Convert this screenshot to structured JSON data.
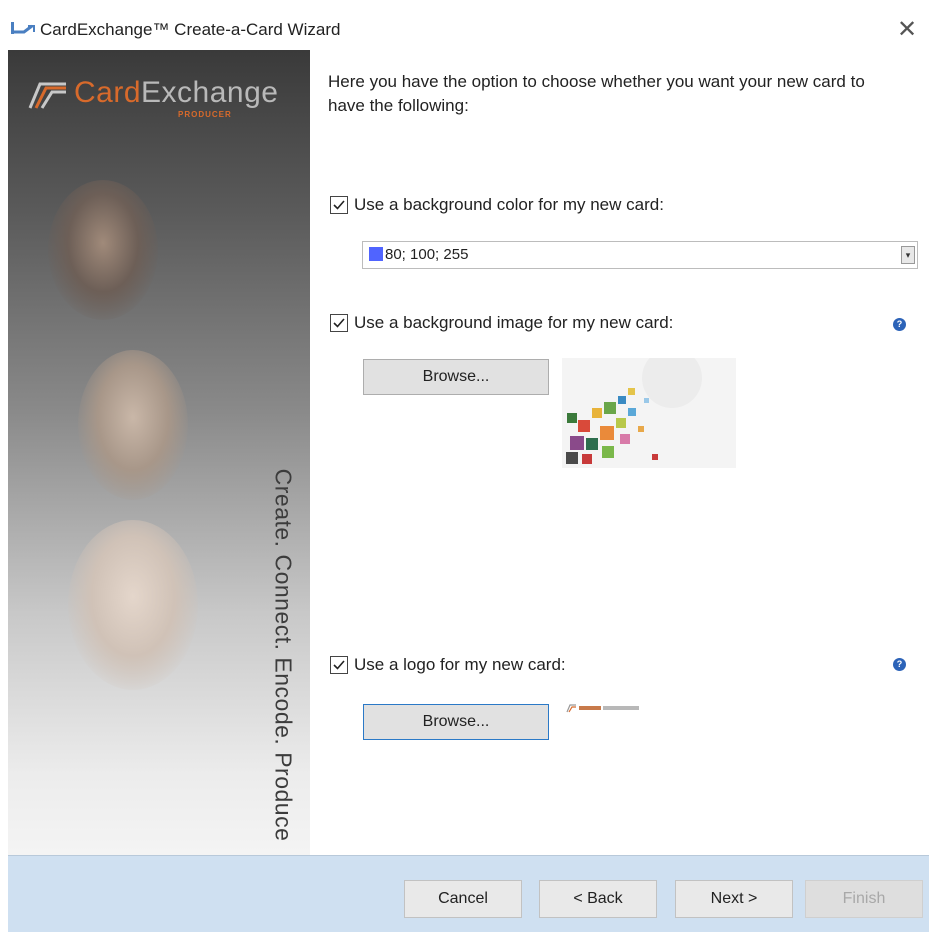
{
  "window": {
    "title": "CardExchange™ Create-a-Card Wizard",
    "app_icon": "cardexchange-app-icon",
    "close_icon": "close-icon"
  },
  "sidebar": {
    "logo": {
      "text_main": "Card",
      "text_accent": "Exchange",
      "subtitle": "PRODUCER"
    },
    "slogan": "Create. Connect. Encode. Produce"
  },
  "main": {
    "intro": "Here you have the option to choose whether you want your new card to have the following:",
    "background_color": {
      "label": "Use a background color for my new card:",
      "checked": true,
      "value": "80; 100; 255",
      "swatch_color": "#5064ff"
    },
    "background_image": {
      "label": "Use a background image for my new card:",
      "checked": true,
      "browse_label": "Browse...",
      "help_icon": "help-icon"
    },
    "logo": {
      "label": "Use a logo for my new card:",
      "checked": true,
      "browse_label": "Browse...",
      "help_icon": "help-icon"
    }
  },
  "footer": {
    "cancel": "Cancel",
    "back": "< Back",
    "next": "Next >",
    "finish": "Finish",
    "finish_enabled": false
  },
  "colors": {
    "footer_bg": "#cfe0f1",
    "logo_orange": "#d86a2b",
    "help_blue": "#2c63b8"
  }
}
